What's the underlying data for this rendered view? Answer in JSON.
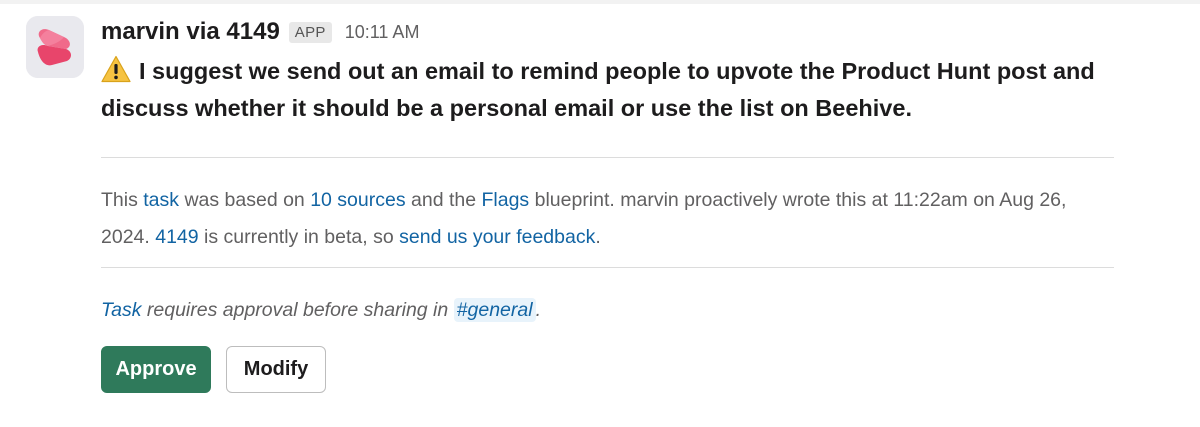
{
  "message": {
    "sender": "marvin via 4149",
    "app_badge": "APP",
    "timestamp": "10:11 AM",
    "avatar_icon": "marvin-logo-icon",
    "headline_icon": "warning-icon",
    "headline": "I suggest we send out an email to remind people to upvote the Product Hunt post and discuss whether it should be a personal email or use the list on Beehive."
  },
  "meta": {
    "t1": "This ",
    "link_task": "task",
    "t2": " was based on ",
    "link_sources": "10 sources",
    "t3": " and the ",
    "link_flags": "Flags",
    "t4": " blueprint. marvin proactively wrote this at 11:22am on Aug 26, 2024. ",
    "link_4149": "4149",
    "t5": " is currently in beta, so ",
    "link_feedback": "send us your feedback",
    "t6": "."
  },
  "approval": {
    "link_task": "Task",
    "text": " requires approval before sharing in ",
    "channel": "#general",
    "end": "."
  },
  "actions": {
    "approve_label": "Approve",
    "modify_label": "Modify"
  },
  "colors": {
    "link": "#1264a3",
    "approve_bg": "#2f7a5b",
    "channel_bg": "#e8f3fb"
  }
}
